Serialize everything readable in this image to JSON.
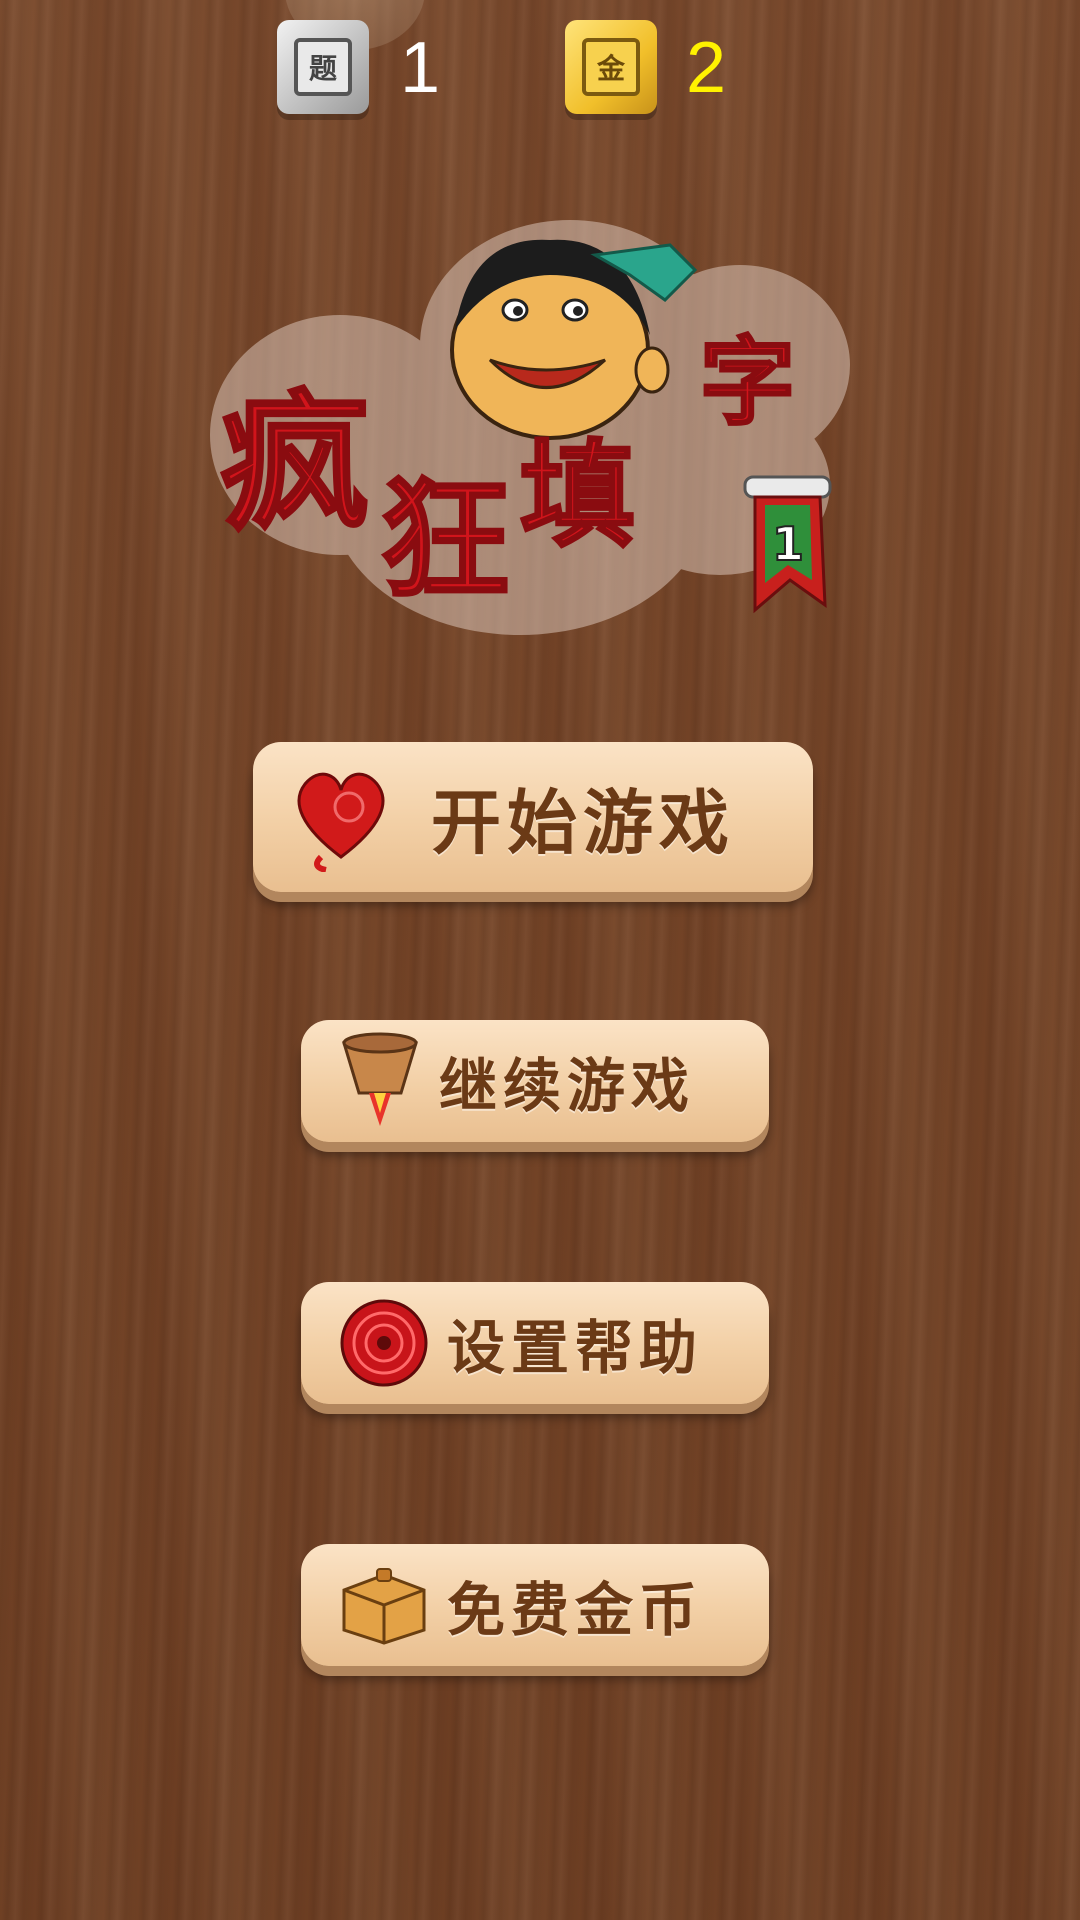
{
  "stats": {
    "questions_icon_glyph": "题",
    "questions_value": "1",
    "gold_icon_glyph": "金",
    "gold_value": "2"
  },
  "logo": {
    "title_chars": [
      "疯",
      "狂",
      "填",
      "字"
    ],
    "badge_number": "1"
  },
  "menu": {
    "start_label": "开始游戏",
    "continue_label": "继续游戏",
    "settings_label": "设置帮助",
    "coins_label": "免费金币"
  },
  "colors": {
    "background": "#744427",
    "button_face": "#f2cfa5",
    "button_text": "#6b3a16",
    "logo_red": "#d1141b",
    "gold_value": "#fff200"
  }
}
